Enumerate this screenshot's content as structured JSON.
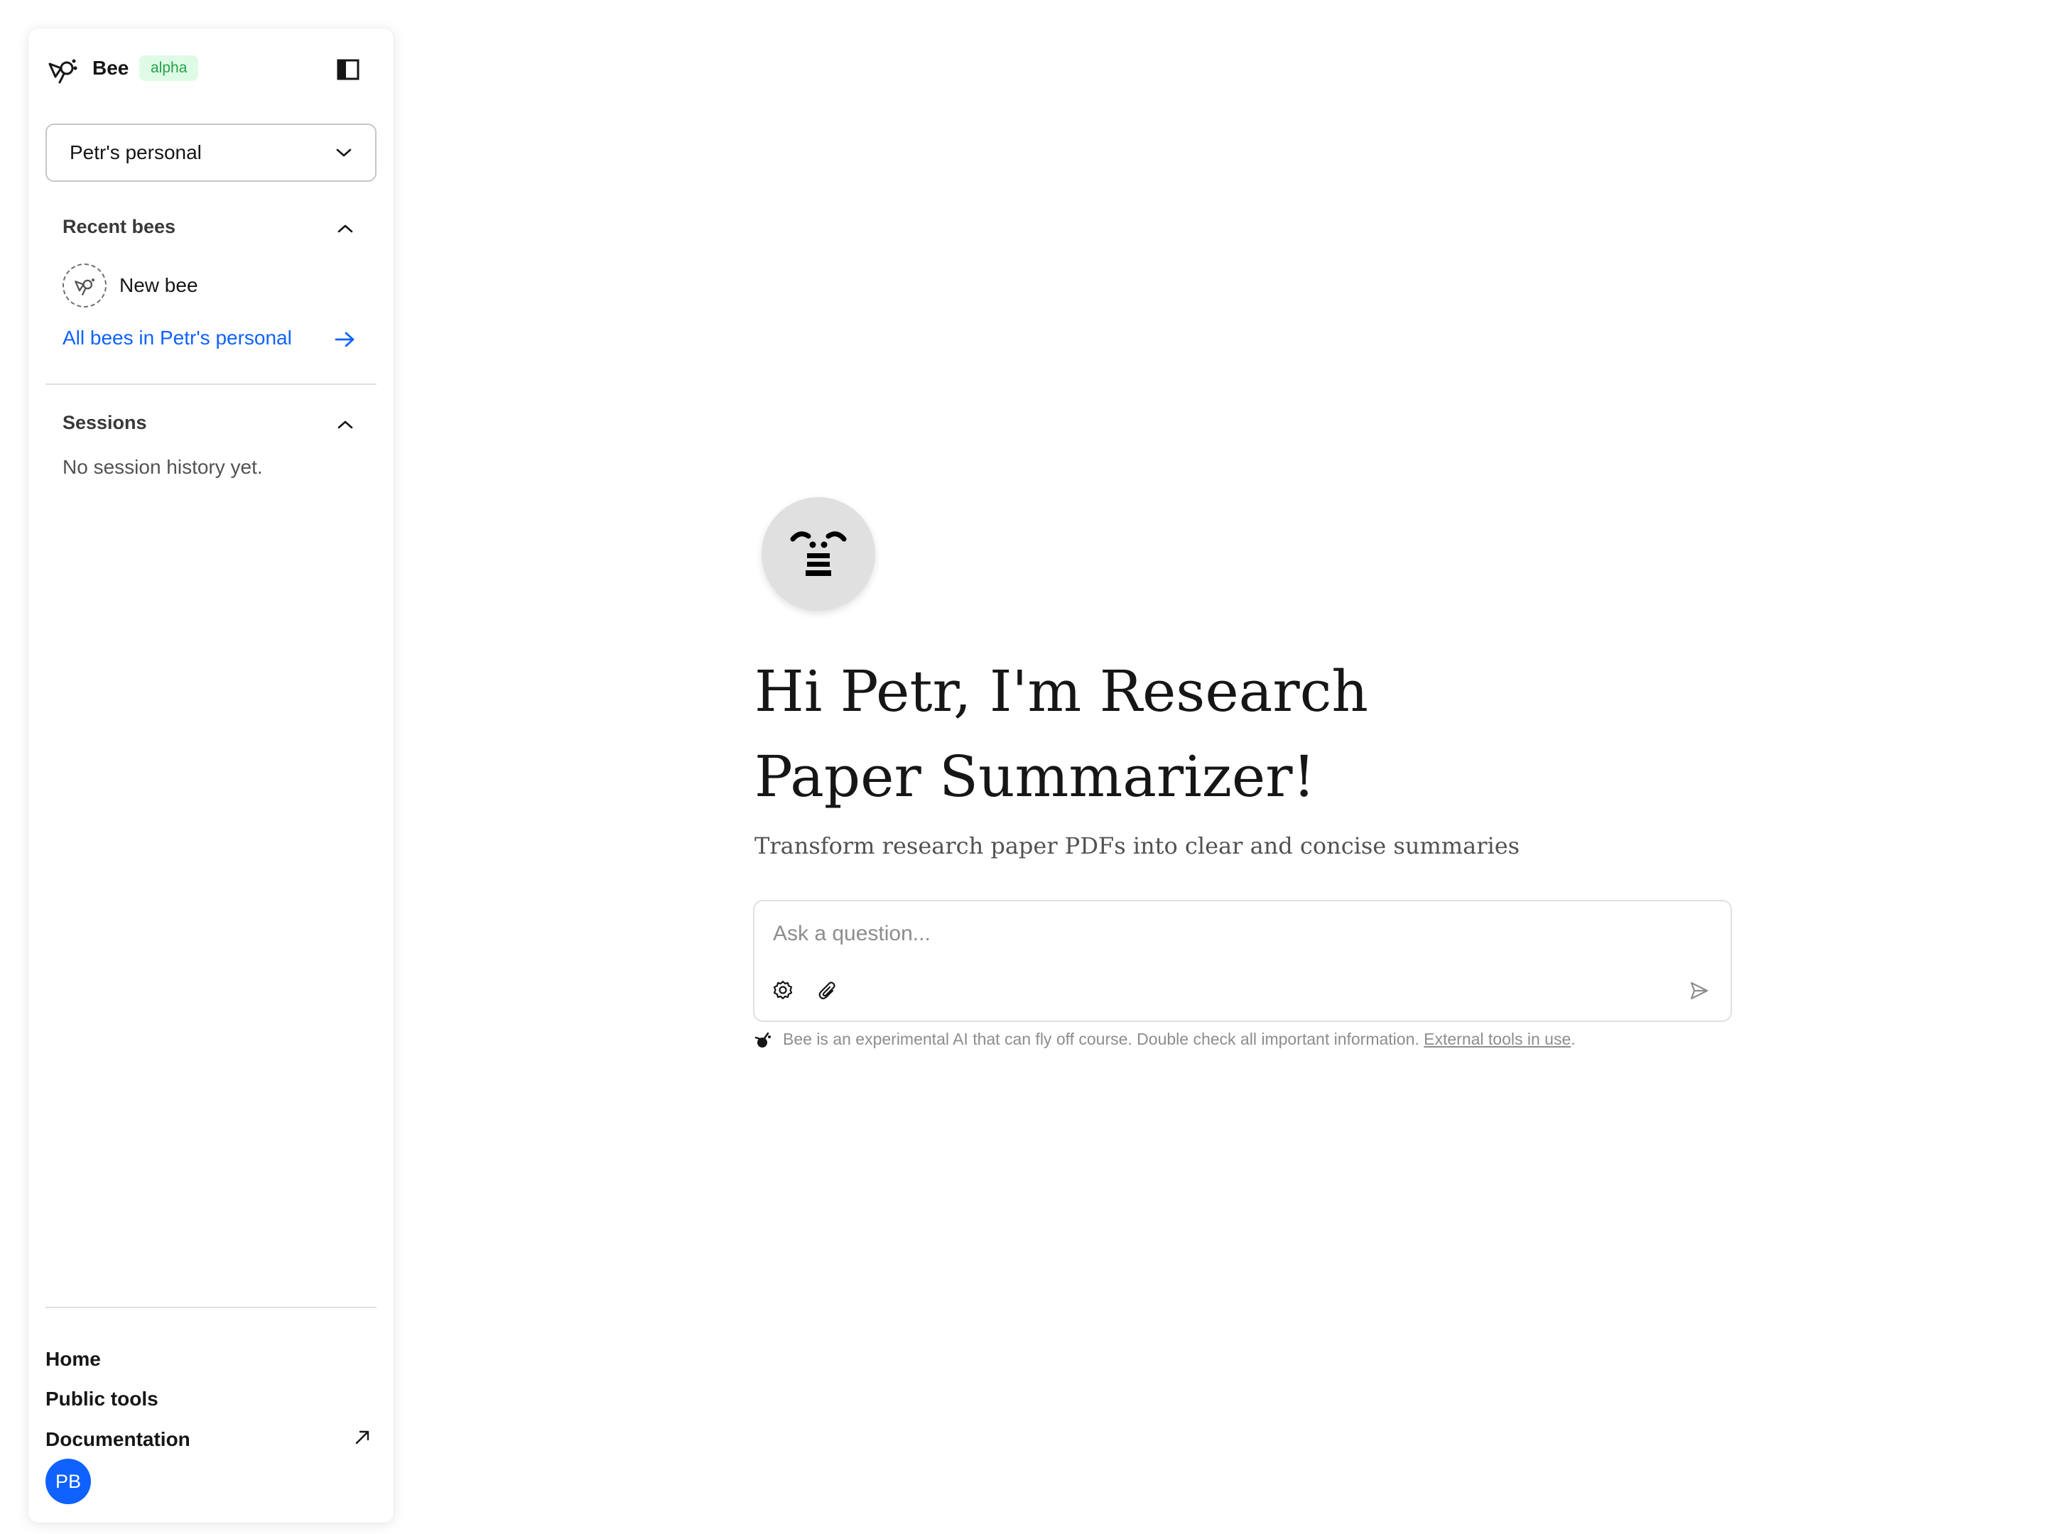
{
  "sidebar": {
    "brand": {
      "name": "Bee",
      "badge": "alpha"
    },
    "space_selector": {
      "value": "Petr's personal"
    },
    "recent_bees": {
      "title": "Recent bees",
      "items": [
        {
          "label": "New bee"
        }
      ],
      "all_link": "All bees in Petr's personal"
    },
    "sessions": {
      "title": "Sessions",
      "empty_text": "No session history yet."
    },
    "footer": {
      "links": [
        "Home",
        "Public tools",
        "Documentation"
      ],
      "avatar_initials": "PB"
    }
  },
  "main": {
    "greeting_line1": "Hi Petr, I'm Research",
    "greeting_line2": "Paper Summarizer!",
    "subtitle": "Transform research paper PDFs into clear and concise summaries",
    "composer": {
      "placeholder": "Ask a question..."
    },
    "disclaimer": {
      "text": "Bee is an experimental AI that can fly off course. Double check all important information.",
      "link": "External tools in use",
      "suffix": "."
    }
  },
  "colors": {
    "accent": "#0f62fe",
    "badge_bg": "#defbe6",
    "badge_text": "#24a148",
    "avatar_bg": "#0f62fe",
    "hero_avatar_bg": "#e0e0e0"
  },
  "icons": {
    "brand": "bee-logo-icon",
    "sidebar_toggle": "sidebar-toggle-icon",
    "select": "chevron-down-icon",
    "collapse": "chevron-up-icon",
    "arrow": "arrow-right-icon",
    "external": "arrow-up-right-icon",
    "settings": "settings-gear-icon",
    "attach": "paperclip-icon",
    "send": "send-icon"
  }
}
